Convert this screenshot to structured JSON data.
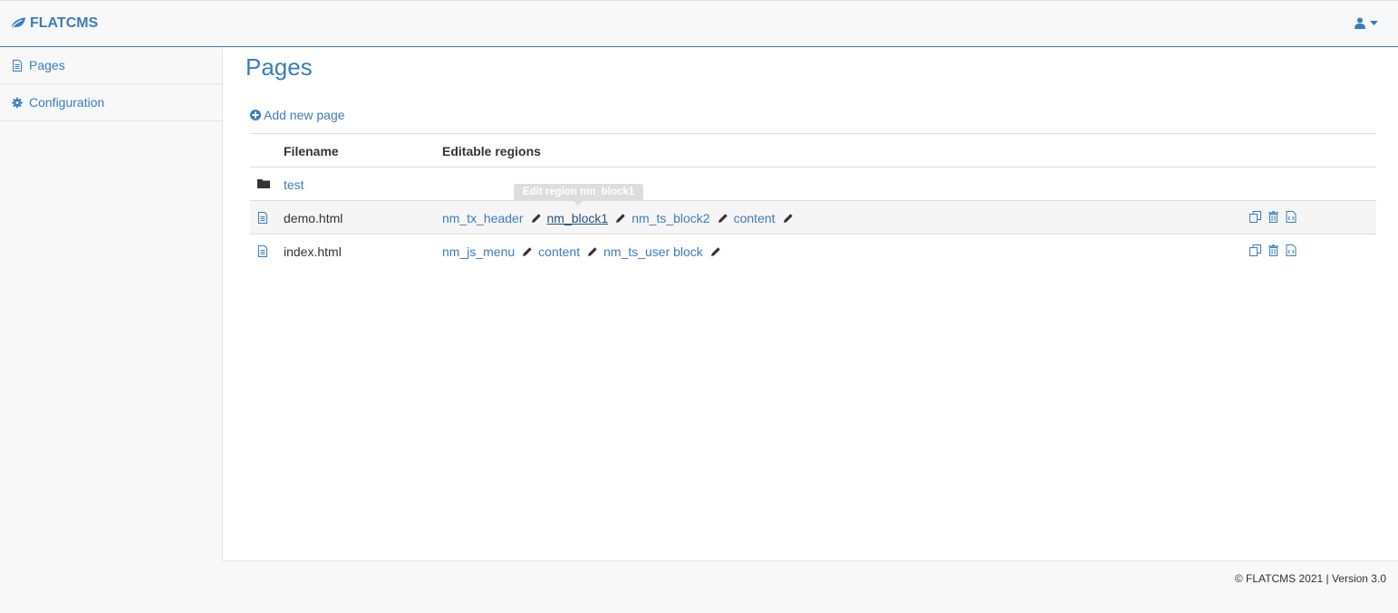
{
  "app": {
    "brand": "FLATCMS",
    "accent_color": "#3a7ebf"
  },
  "sidebar": {
    "items": [
      {
        "label": "Pages",
        "icon": "file-text-icon"
      },
      {
        "label": "Configuration",
        "icon": "gear-icon"
      }
    ]
  },
  "main": {
    "title": "Pages",
    "add_page_label": "Add new page",
    "table": {
      "headers": {
        "filename": "Filename",
        "regions": "Editable regions"
      },
      "rows": [
        {
          "type": "folder",
          "name": "test",
          "regions": []
        },
        {
          "type": "file",
          "name": "demo.html",
          "regions": [
            "nm_tx_header",
            "nm_block1",
            "nm_ts_block2",
            "content"
          ]
        },
        {
          "type": "file",
          "name": "index.html",
          "regions": [
            "nm_js_menu",
            "content",
            "nm_ts_user block"
          ]
        }
      ]
    },
    "tooltip": "Edit region nm_block1"
  },
  "footer": {
    "text": "© FLATCMS 2021 | Version 3.0"
  }
}
